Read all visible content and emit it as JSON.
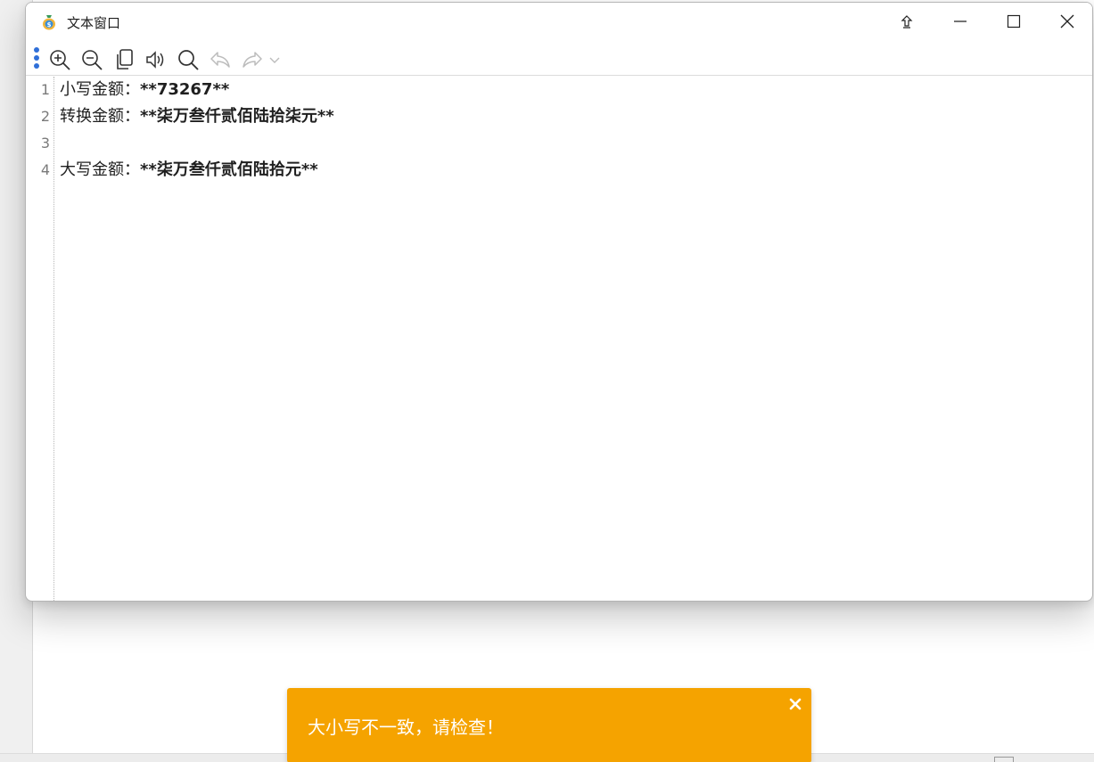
{
  "window": {
    "title": "文本窗口"
  },
  "toolbar": {
    "items": [
      {
        "name": "zoom-in-icon"
      },
      {
        "name": "zoom-out-icon"
      },
      {
        "name": "copy-icon"
      },
      {
        "name": "speaker-icon"
      },
      {
        "name": "search-icon"
      },
      {
        "name": "undo-icon"
      },
      {
        "name": "redo-icon"
      },
      {
        "name": "chevron-down-icon"
      }
    ]
  },
  "editor": {
    "lines": [
      {
        "number": "1",
        "label": "小写金额：",
        "value": "**73267**"
      },
      {
        "number": "2",
        "label": "转换金额：",
        "value": "**柒万叁仟贰佰陆拾柒元**"
      },
      {
        "number": "3",
        "label": "",
        "value": ""
      },
      {
        "number": "4",
        "label": "大写金额：",
        "value": "**柒万叁仟贰佰陆拾元**"
      }
    ]
  },
  "toast": {
    "message": "大小写不一致，请检查！",
    "color": "#f5a300"
  },
  "colors": {
    "accent": "#2f6fd8",
    "toast": "#f5a300"
  }
}
